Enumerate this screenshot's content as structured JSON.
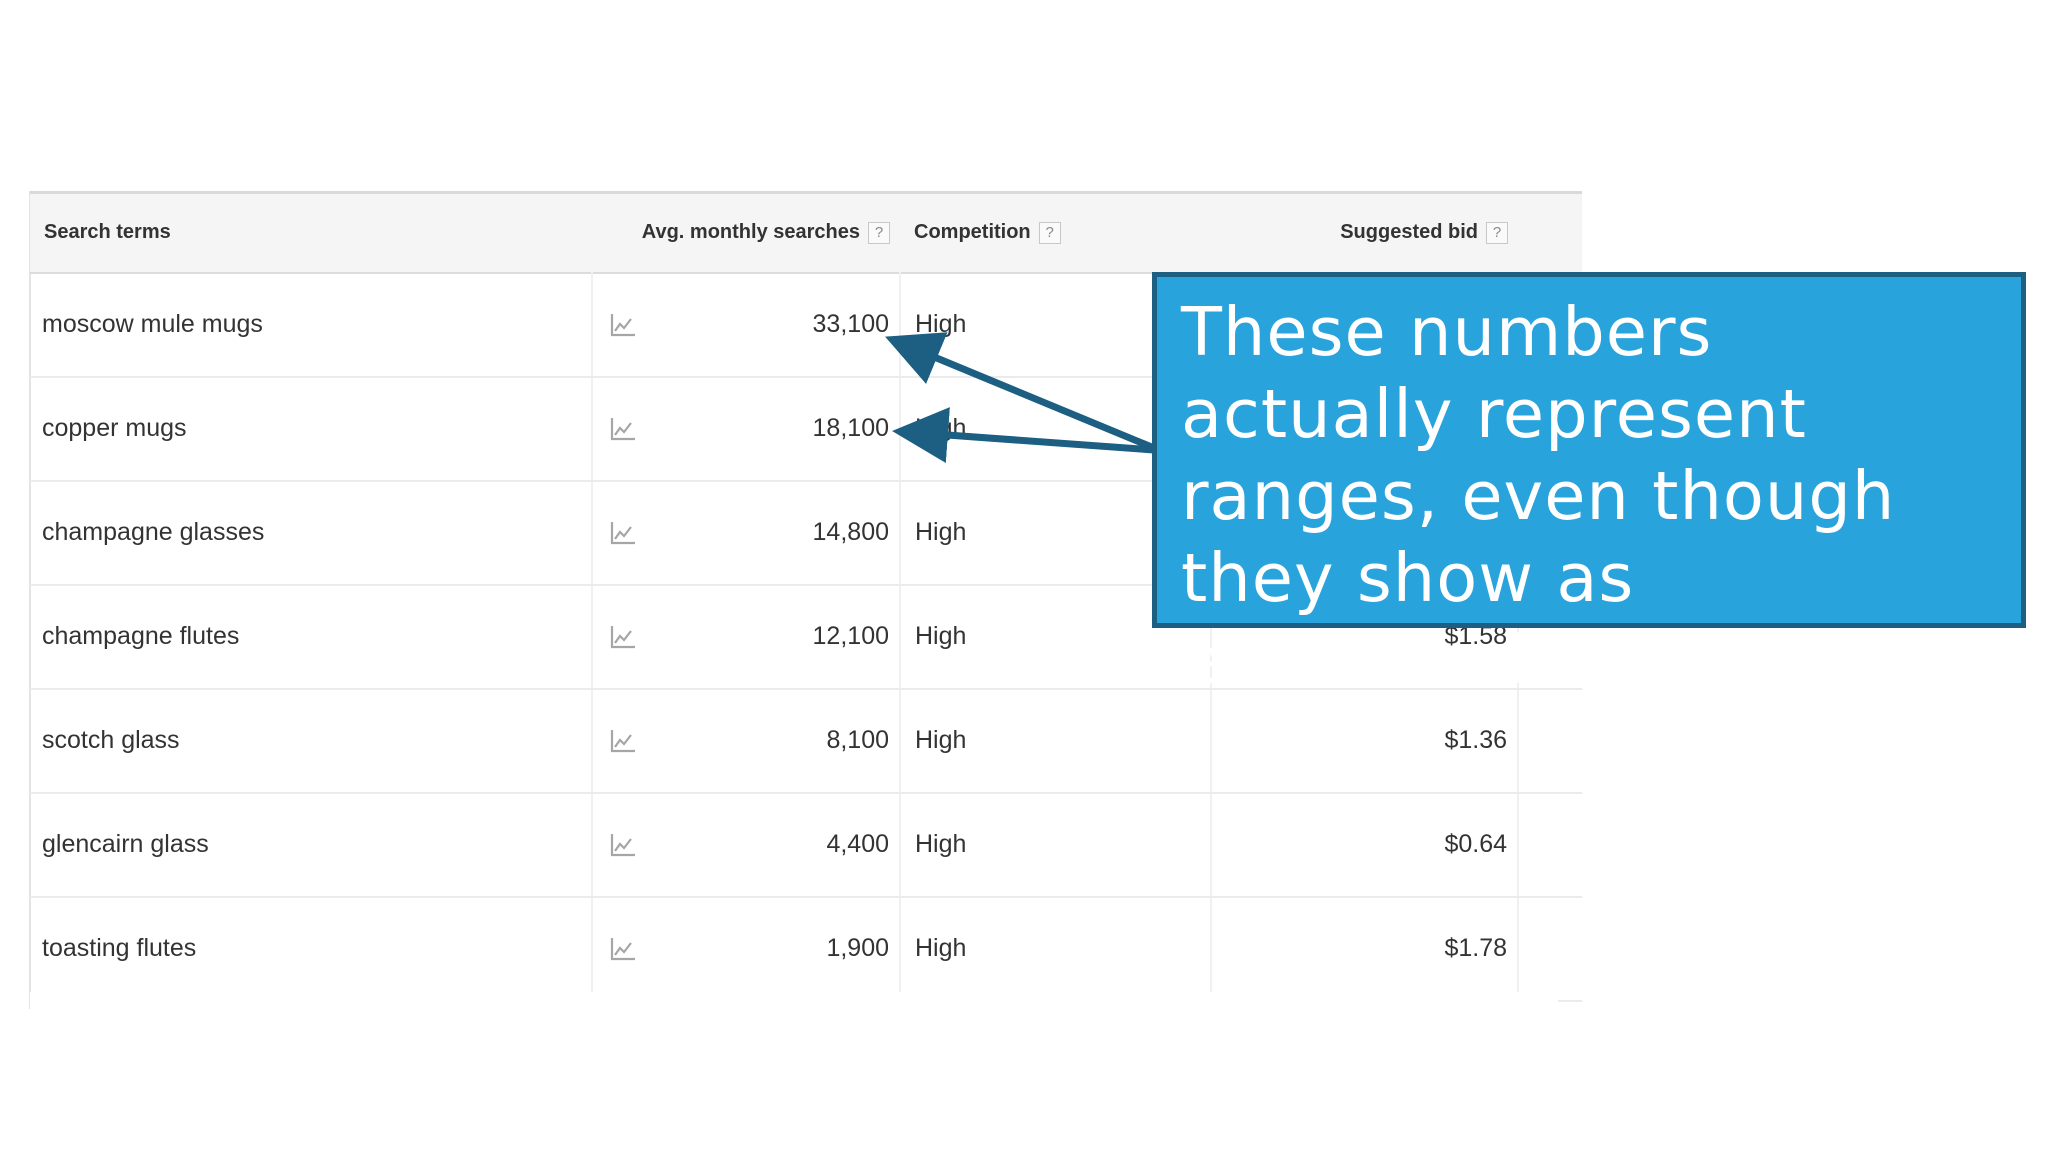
{
  "table": {
    "headers": {
      "search_terms": "Search terms",
      "avg_monthly_searches": "Avg. monthly searches",
      "competition": "Competition",
      "suggested_bid": "Suggested bid",
      "help_glyph": "?"
    },
    "rows": [
      {
        "term": "moscow mule mugs",
        "searches": "33,100",
        "competition": "High",
        "bid": ""
      },
      {
        "term": "copper mugs",
        "searches": "18,100",
        "competition": "High",
        "bid": ""
      },
      {
        "term": "champagne glasses",
        "searches": "14,800",
        "competition": "High",
        "bid": ""
      },
      {
        "term": "champagne flutes",
        "searches": "12,100",
        "competition": "High",
        "bid": "$1.58"
      },
      {
        "term": "scotch glass",
        "searches": "8,100",
        "competition": "High",
        "bid": "$1.36"
      },
      {
        "term": "glencairn glass",
        "searches": "4,400",
        "competition": "High",
        "bid": "$0.64"
      },
      {
        "term": "toasting flutes",
        "searches": "1,900",
        "competition": "High",
        "bid": "$1.78"
      }
    ]
  },
  "icons": {
    "trend": "line-chart-icon",
    "help": "question-mark-icon"
  },
  "callout": {
    "text": "These numbers actually represent ranges, even though they show as estimated averages"
  },
  "colors": {
    "callout_fill": "#29a3dc",
    "callout_border": "#1c5f82",
    "arrow": "#1c5f82",
    "header_bg": "#f5f5f5"
  }
}
